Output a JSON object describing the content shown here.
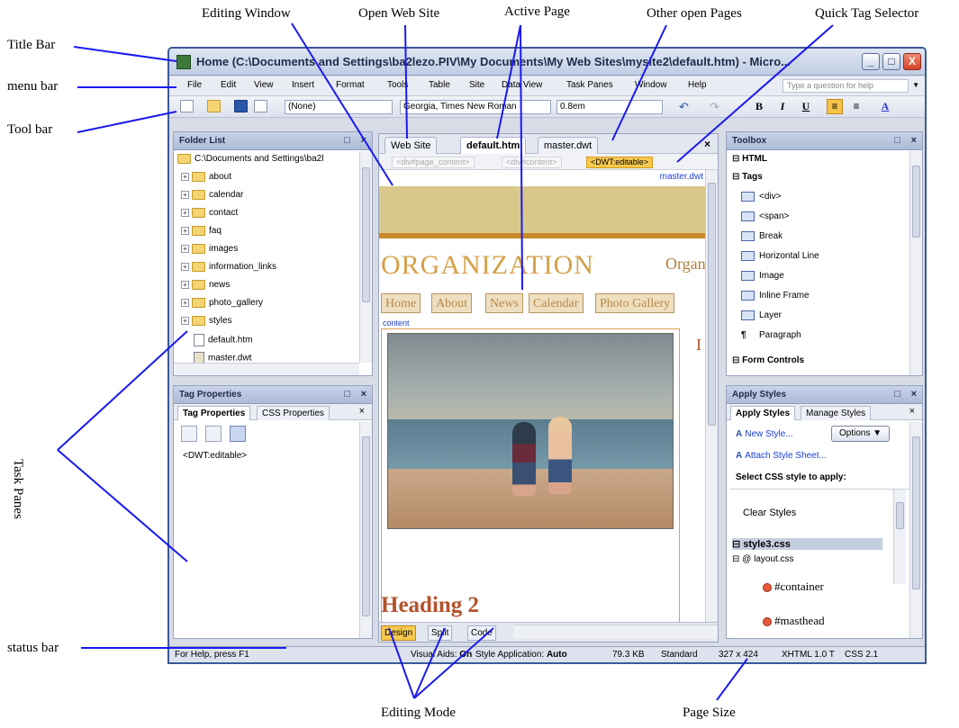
{
  "annotations": {
    "title_bar": "Title Bar",
    "menu_bar": "menu bar",
    "tool_bar": "Tool bar",
    "task_panes": "Task Panes",
    "status_bar": "status bar",
    "editing_window": "Editing Window",
    "open_web_site": "Open Web Site",
    "active_page": "Active Page",
    "other_open_pages": "Other open Pages",
    "quick_tag_selector": "Quick Tag Selector",
    "editing_mode": "Editing Mode",
    "page_size": "Page Size"
  },
  "window": {
    "title": "Home (C:\\Documents and Settings\\ba2lezo.PIV\\My Documents\\My Web Sites\\mysite2\\default.htm) - Micro...",
    "minimize_glyph": "_",
    "maximize_glyph": "□",
    "close_glyph": "X"
  },
  "menu": {
    "items": [
      "File",
      "Edit",
      "View",
      "Insert",
      "Format",
      "Tools",
      "Table",
      "Site",
      "Data View",
      "Task Panes",
      "Window",
      "Help"
    ],
    "help_placeholder": "Type a question for help"
  },
  "toolbar": {
    "style_combo": "(None)",
    "font_combo": "Georgia, Times New Roman",
    "size_combo": "0.8em",
    "bold": "B",
    "italic": "I",
    "underline": "U",
    "font_color": "A"
  },
  "folder_list": {
    "title": "Folder List",
    "root": "C:\\Documents and Settings\\ba2l",
    "folders": [
      "about",
      "calendar",
      "contact",
      "faq",
      "images",
      "information_links",
      "news",
      "photo_gallery",
      "styles"
    ],
    "files": [
      "default.htm",
      "master.dwt"
    ]
  },
  "tag_properties": {
    "title": "Tag Properties",
    "tabs": [
      "Tag Properties",
      "CSS Properties"
    ],
    "current_tag": "<DWT:editable>"
  },
  "document": {
    "tabs": [
      "Web Site",
      "default.htm",
      "master.dwt"
    ],
    "quick_tags": [
      "<div#page_content>",
      "<div#content>",
      "<DWT:editable>"
    ],
    "master_link": "master.dwt",
    "org_title": "ORGANIZATION",
    "org_right": "Organ",
    "nav": [
      "Home",
      "About",
      "News",
      "Calendar",
      "Photo Gallery"
    ],
    "content_label": "content",
    "heading": "Heading 2",
    "right_letter": "I",
    "modes": [
      "Design",
      "Split",
      "Code"
    ]
  },
  "toolbox": {
    "title": "Toolbox",
    "section_html": "HTML",
    "section_tags": "Tags",
    "tags": [
      "<div>",
      "<span>",
      "Break",
      "Horizontal Line",
      "Image",
      "Inline Frame",
      "Layer",
      "Paragraph"
    ],
    "section_forms": "Form Controls"
  },
  "apply_styles": {
    "title": "Apply Styles",
    "tabs": [
      "Apply Styles",
      "Manage Styles"
    ],
    "new_style": "New Style...",
    "options": "Options ▼",
    "attach": "Attach Style Sheet...",
    "select_label": "Select CSS style to apply:",
    "clear": "Clear Styles",
    "sheet1": "style3.css",
    "sheet2": "layout.css",
    "rules": [
      "#container",
      "#masthead"
    ]
  },
  "status": {
    "help_text": "For Help, press F1",
    "visual_aids_label": "Visual Aids:",
    "visual_aids_value": "On",
    "style_app_label": "Style Application:",
    "style_app_value": "Auto",
    "file_size": "79.3 KB",
    "mode": "Standard",
    "page_size": "327 x 424",
    "doctype": "XHTML 1.0 T",
    "css": "CSS 2.1"
  },
  "colors": {
    "accent": "#f7c94f",
    "annotation_line": "#1a1af0",
    "heading": "#b5522a"
  }
}
